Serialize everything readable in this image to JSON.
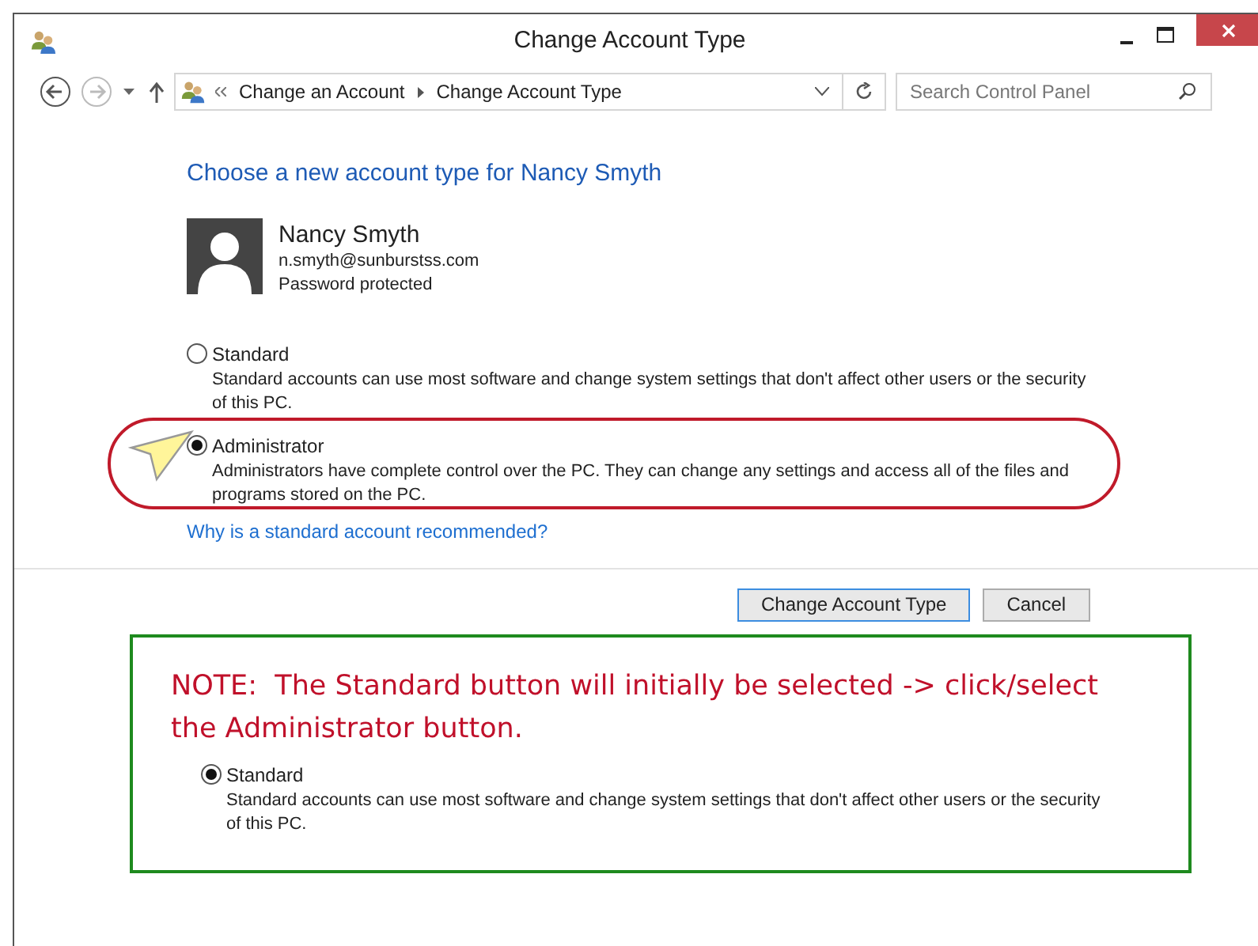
{
  "window": {
    "title": "Change Account Type"
  },
  "address": {
    "breadcrumbs": [
      "Change an Account",
      "Change Account Type"
    ]
  },
  "search": {
    "placeholder": "Search Control Panel"
  },
  "heading": "Choose a new account type for Nancy Smyth",
  "user": {
    "name": "Nancy Smyth",
    "email": "n.smyth@sunburstss.com",
    "status": "Password protected"
  },
  "options": [
    {
      "label": "Standard",
      "description": "Standard accounts can use most software and change system settings that don't affect other users or the security of this PC.",
      "selected": false,
      "highlighted": false
    },
    {
      "label": "Administrator",
      "description": "Administrators have complete control over the PC. They can change any settings and access all of the files and programs stored on the PC.",
      "selected": true,
      "highlighted": true
    }
  ],
  "link": "Why is a standard account recommended?",
  "buttons": [
    {
      "label": "Change Account Type",
      "default": true
    },
    {
      "label": "Cancel",
      "default": false
    }
  ],
  "note": {
    "text": "NOTE:  The Standard button will initially be selected -> click/select the Administrator button.",
    "option": {
      "label": "Standard",
      "description": "Standard accounts can use most software and change system settings that don't affect other users or the security of this PC.",
      "selected": true
    }
  }
}
